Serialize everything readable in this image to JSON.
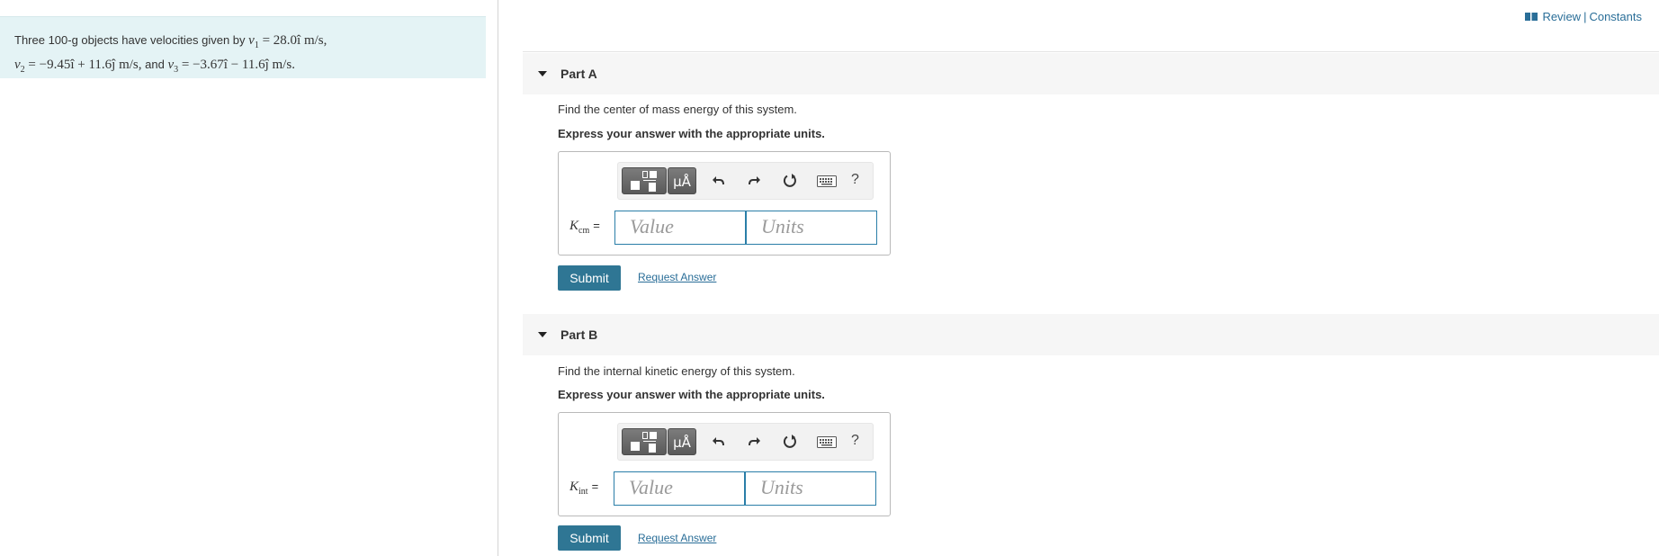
{
  "problem": {
    "intro": "Three 100-g objects have velocities given by",
    "v1_label": "v",
    "v1_sub": "1",
    "v1_value": " = 28.0î m/s,",
    "v2_label": "v",
    "v2_sub": "2",
    "v2_value": " = −9.45î + 11.6ĵ m/s,",
    "and_text": " and ",
    "v3_label": "v",
    "v3_sub": "3",
    "v3_value": " = −3.67î − 11.6ĵ m/s."
  },
  "header": {
    "review": "Review",
    "separator": "|",
    "constants": "Constants"
  },
  "parts": [
    {
      "title": "Part A",
      "prompt": "Find the center of mass energy of this system.",
      "instruction": "Express your answer with the appropriate units.",
      "var_symbol": "K",
      "var_sub": "cm",
      "equals": "=",
      "value_placeholder": "Value",
      "units_placeholder": "Units",
      "submit": "Submit",
      "request": "Request Answer"
    },
    {
      "title": "Part B",
      "prompt": "Find the internal kinetic energy of this system.",
      "instruction": "Express your answer with the appropriate units.",
      "var_symbol": "K",
      "var_sub": "int",
      "equals": "=",
      "value_placeholder": "Value",
      "units_placeholder": "Units",
      "submit": "Submit",
      "request": "Request Answer"
    }
  ],
  "toolbar": {
    "symbols_label": "μÅ",
    "help_label": "?"
  },
  "icons": {
    "book": "book-icon",
    "templates": "templates-icon",
    "undo": "undo-icon",
    "redo": "redo-icon",
    "reset": "reset-icon",
    "keyboard": "keyboard-icon"
  },
  "colors": {
    "accent": "#2f7694",
    "link": "#2a6e98",
    "problem_bg": "#e4f3f5"
  }
}
